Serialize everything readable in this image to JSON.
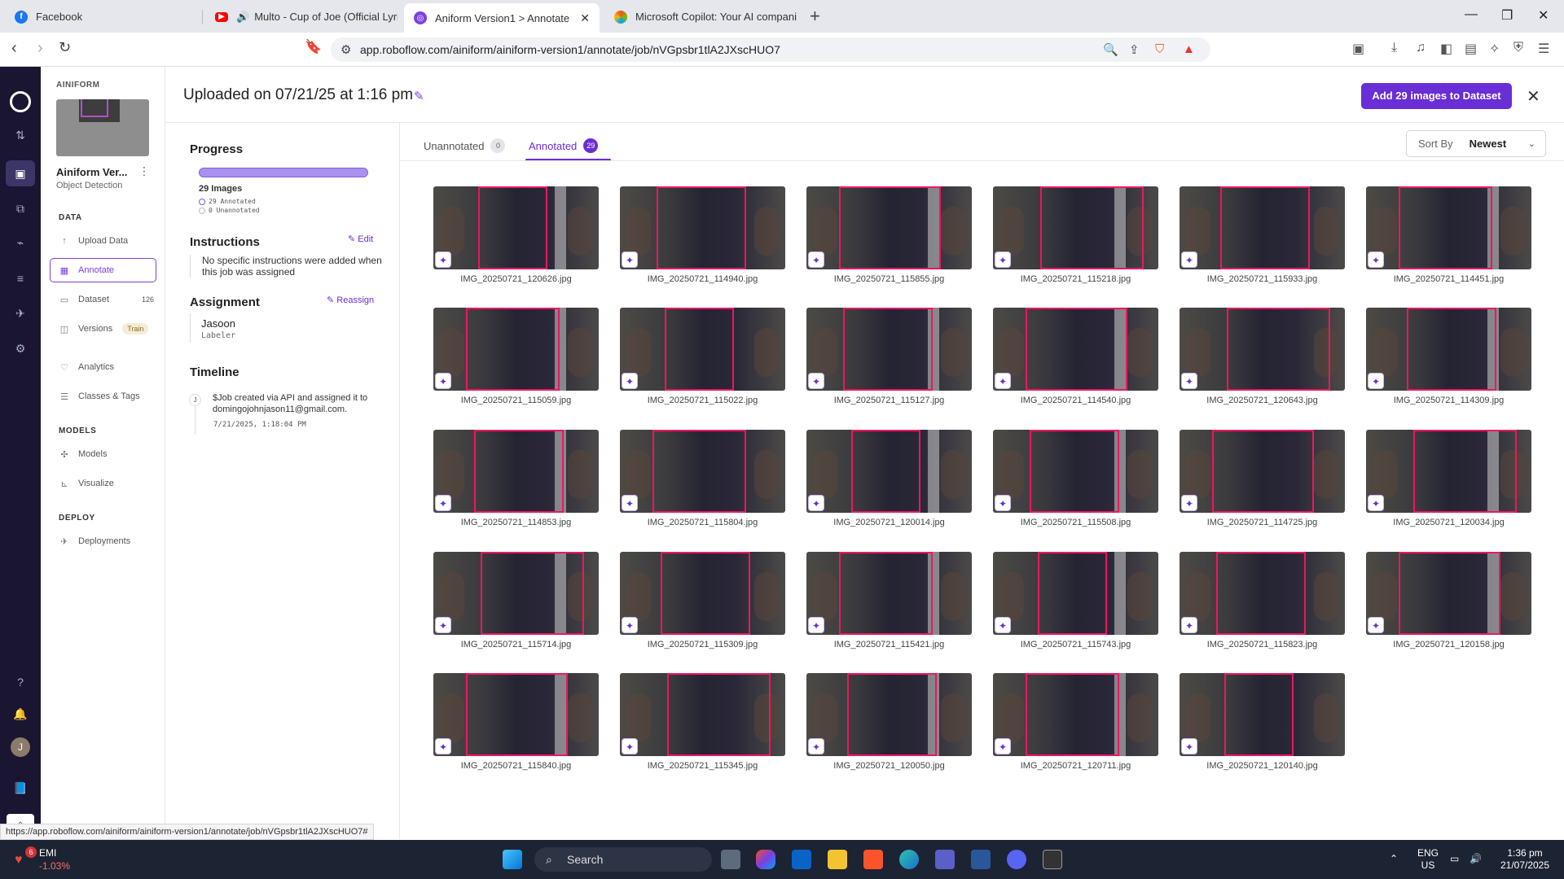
{
  "browser": {
    "tabs": [
      {
        "title": "Facebook",
        "active": false
      },
      {
        "title": "Multo - Cup of Joe (Official Lyric",
        "active": false
      },
      {
        "title": "Aniform Version1 > Annotate",
        "active": true
      },
      {
        "title": "Microsoft Copilot: Your AI companion",
        "active": false
      }
    ],
    "url": "app.roboflow.com/ainiform/ainiform-version1/annotate/job/nVGpsbr1tlA2JXscHUO7",
    "status_url": "https://app.roboflow.com/ainiform/ainiform-version1/annotate/job/nVGpsbr1tlA2JXscHUO7#"
  },
  "sidebar": {
    "workspace": "AINIFORM",
    "project_name": "Ainiform Ver...",
    "project_type": "Object Detection",
    "sections": {
      "data": "DATA",
      "models": "MODELS",
      "deploy": "DEPLOY"
    },
    "items": {
      "upload": "Upload Data",
      "annotate": "Annotate",
      "dataset": "Dataset",
      "dataset_count": "126",
      "versions": "Versions",
      "versions_pill": "Train",
      "analytics": "Analytics",
      "classes": "Classes & Tags",
      "models": "Models",
      "visualize": "Visualize",
      "deployments": "Deployments"
    },
    "avatar_initial": "J"
  },
  "header": {
    "title": "Uploaded on 07/21/25 at 1:16 pm",
    "add_button": "Add 29 images to Dataset"
  },
  "job": {
    "progress_heading": "Progress",
    "progress_fraction": 1.0,
    "images_count": "29 Images",
    "annotated_line": "29 Annotated",
    "unannotated_line": "0 Unannotated",
    "instructions_heading": "Instructions",
    "edit_label": "Edit",
    "instructions_text": "No specific instructions were added when this job was assigned",
    "assignment_heading": "Assignment",
    "reassign_label": "Reassign",
    "assignee": "Jasoon",
    "assignee_role": "Labeler",
    "timeline_heading": "Timeline",
    "timeline_avatar": "J",
    "timeline_text": "$Job created via API and assigned it to domingojohnjason11@gmail.com.",
    "timeline_time": "7/21/2025, 1:18:04 PM"
  },
  "tabs": {
    "unannotated": "Unannotated",
    "unannotated_count": "0",
    "annotated": "Annotated",
    "annotated_count": "29"
  },
  "sort": {
    "label": "Sort By",
    "value": "Newest"
  },
  "images": [
    "IMG_20250721_120626.jpg",
    "IMG_20250721_114940.jpg",
    "IMG_20250721_115855.jpg",
    "IMG_20250721_115218.jpg",
    "IMG_20250721_115933.jpg",
    "IMG_20250721_114451.jpg",
    "IMG_20250721_115059.jpg",
    "IMG_20250721_115022.jpg",
    "IMG_20250721_115127.jpg",
    "IMG_20250721_114540.jpg",
    "IMG_20250721_120643.jpg",
    "IMG_20250721_114309.jpg",
    "IMG_20250721_114853.jpg",
    "IMG_20250721_115804.jpg",
    "IMG_20250721_120014.jpg",
    "IMG_20250721_115508.jpg",
    "IMG_20250721_114725.jpg",
    "IMG_20250721_120034.jpg",
    "IMG_20250721_115714.jpg",
    "IMG_20250721_115309.jpg",
    "IMG_20250721_115421.jpg",
    "IMG_20250721_115743.jpg",
    "IMG_20250721_115823.jpg",
    "IMG_20250721_120158.jpg",
    "IMG_20250721_115840.jpg",
    "IMG_20250721_115345.jpg",
    "IMG_20250721_120050.jpg",
    "IMG_20250721_120711.jpg",
    "IMG_20250721_120140.jpg"
  ],
  "taskbar": {
    "stock_name": "EMI",
    "stock_change": "-1.03%",
    "notif_count": "6",
    "search_label": "Search",
    "lang": "ENG",
    "region": "US",
    "time": "1:36 pm",
    "date": "21/07/2025"
  },
  "colors": {
    "accent": "#6a2ed6",
    "bbox": "#ee1661",
    "rail": "#1a1530"
  }
}
